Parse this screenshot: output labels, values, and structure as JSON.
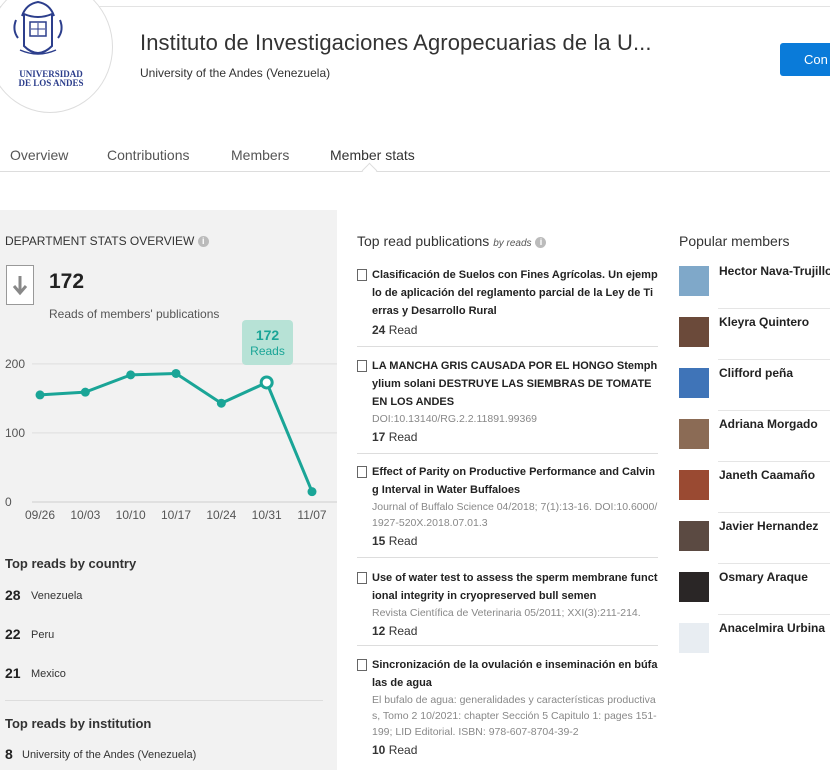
{
  "header": {
    "title": "Instituto de Investigaciones Agropecuarias de la U...",
    "subtitle": "University of the Andes (Venezuela)",
    "follow_label": "Con",
    "logo_text": "UNIVERSIDAD DE LOS ANDES"
  },
  "tabs": [
    {
      "label": "Overview"
    },
    {
      "label": "Contributions"
    },
    {
      "label": "Members"
    },
    {
      "label": "Member stats"
    }
  ],
  "stats": {
    "heading": "DEPARTMENT STATS OVERVIEW",
    "reads": "172",
    "reads_label": "Reads of members' publications",
    "tooltip_value": "172",
    "tooltip_label": "Reads"
  },
  "chart_data": {
    "type": "line",
    "categories": [
      "09/26",
      "10/03",
      "10/10",
      "10/17",
      "10/24",
      "10/31",
      "11/07"
    ],
    "values": [
      155,
      159,
      184,
      186,
      143,
      173,
      15
    ],
    "yticks": [
      0,
      100,
      200
    ],
    "ylim": [
      0,
      220
    ],
    "color": "#1aa597",
    "highlight_index": 5
  },
  "countries": {
    "heading": "Top reads by country",
    "items": [
      {
        "count": "28",
        "name": "Venezuela"
      },
      {
        "count": "22",
        "name": "Peru"
      },
      {
        "count": "21",
        "name": "Mexico"
      }
    ]
  },
  "institutions": {
    "heading": "Top reads by institution",
    "items": [
      {
        "count": "8",
        "name": "University of the Andes (Venezuela)"
      }
    ]
  },
  "publications": {
    "heading": "Top read publications",
    "by": "by reads",
    "items": [
      {
        "title": "Clasificación de Suelos con Fines Agrícolas. Un ejemplo de aplicación del reglamento parcial de la Ley de Tierras y Desarrollo Rural",
        "meta": "",
        "reads": "24",
        "reads_label": "Read"
      },
      {
        "title": "LA MANCHA GRIS CAUSADA POR EL HONGO Stemphylium solani DESTRUYE LAS SIEMBRAS DE TOMATE EN LOS ANDES",
        "meta": "DOI:10.13140/RG.2.2.11891.99369",
        "reads": "17",
        "reads_label": "Read"
      },
      {
        "title": "Effect of Parity on Productive Performance and Calving Interval in Water Buffaloes",
        "meta": "Journal of Buffalo Science 04/2018; 7(1):13-16. DOI:10.6000/1927-520X.2018.07.01.3",
        "reads": "15",
        "reads_label": "Read"
      },
      {
        "title": "Use of water test to assess the sperm membrane functional integrity in cryopreserved bull semen",
        "meta": "Revista Científica de Veterinaria 05/2011; XXI(3):211-214.",
        "reads": "12",
        "reads_label": "Read"
      },
      {
        "title": "Sincronización de la ovulación e inseminación en búfalas de agua",
        "meta": "El bufalo de agua: generalidades y características productivas, Tomo 2 10/2021: chapter Sección 5 Capitulo 1: pages 151-199; LID Editorial. ISBN: 978-607-8704-39-2",
        "reads": "10",
        "reads_label": "Read"
      }
    ]
  },
  "members": {
    "heading": "Popular members",
    "items": [
      {
        "name": "Hector Nava-Trujillo",
        "avatar_color": "#7fa8c9"
      },
      {
        "name": "Kleyra Quintero",
        "avatar_color": "#6b4a3a"
      },
      {
        "name": "Clifford peña",
        "avatar_color": "#3f74b8"
      },
      {
        "name": "Adriana Morgado",
        "avatar_color": "#8b6b55"
      },
      {
        "name": "Janeth Caamaño",
        "avatar_color": "#9a4a32"
      },
      {
        "name": "Javier Hernandez",
        "avatar_color": "#5b4a42"
      },
      {
        "name": "Osmary Araque",
        "avatar_color": "#2a2626"
      },
      {
        "name": "Anacelmira Urbina",
        "avatar_color": "#e8edf2"
      }
    ]
  }
}
